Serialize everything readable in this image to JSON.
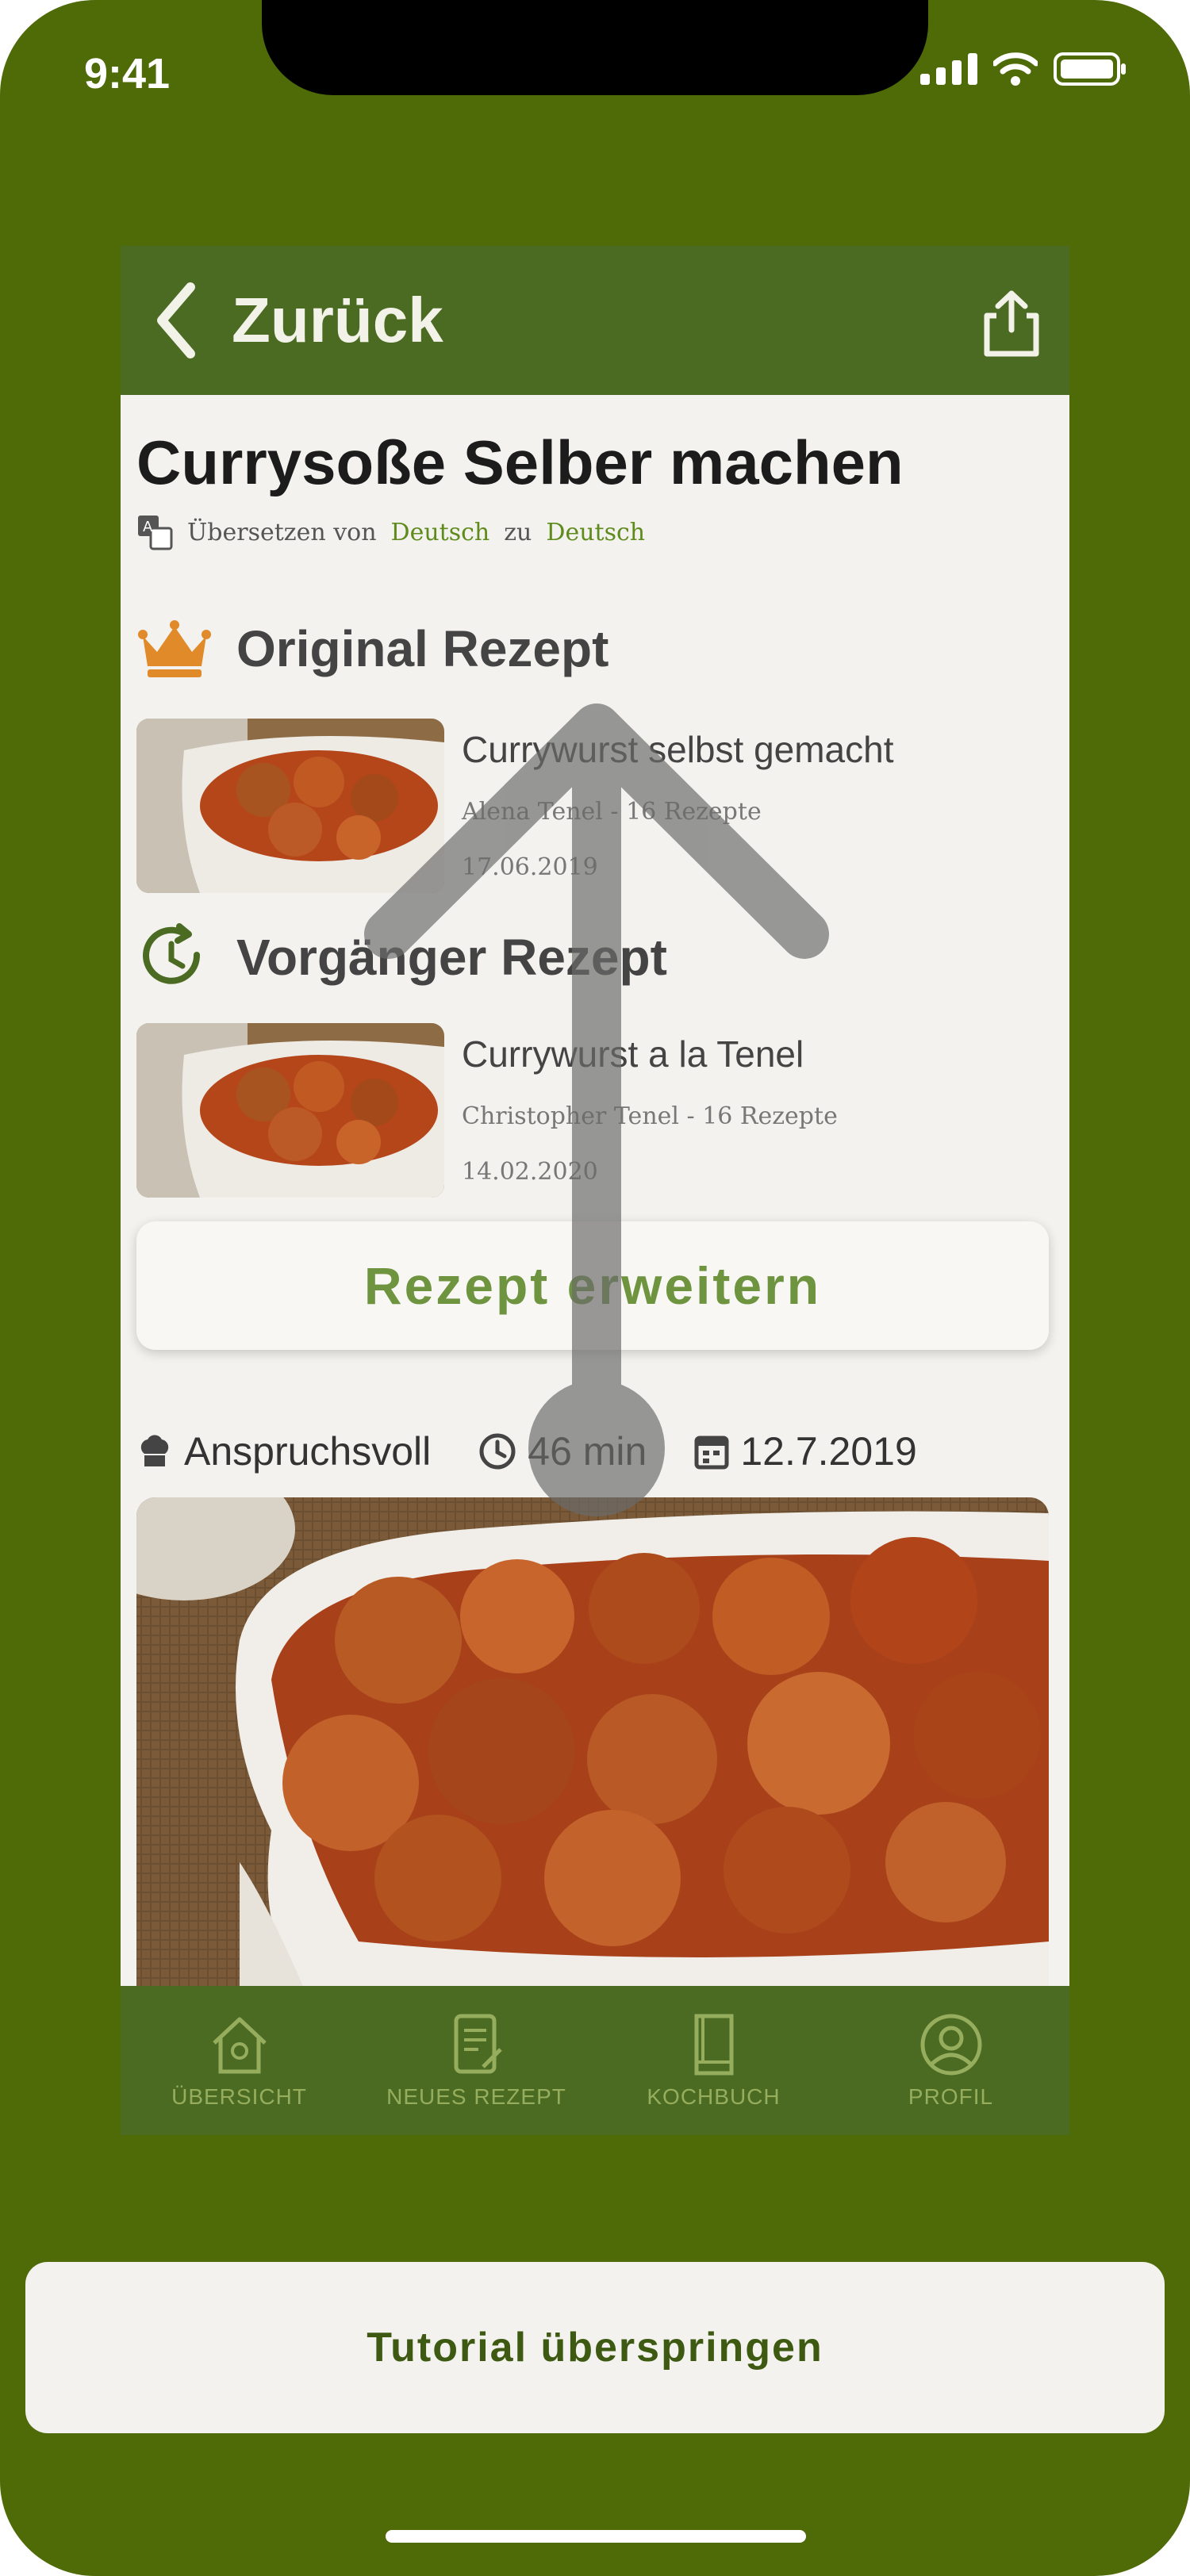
{
  "status_bar": {
    "time": "9:41"
  },
  "app_bar": {
    "back_label": "Zurück"
  },
  "recipe": {
    "title": "Currysoße Selber machen",
    "translation": {
      "prefix": "Übersetzen von",
      "from": "Deutsch",
      "connector": "zu",
      "to": "Deutsch"
    }
  },
  "original": {
    "heading": "Original Rezept",
    "title": "Currywurst selbst gemacht",
    "author_line": "Alena Tenel - 16 Rezepte",
    "date": "17.06.2019"
  },
  "predecessor": {
    "heading": "Vorgänger Rezept",
    "title": "Currywurst a la Tenel",
    "author_line": "Christopher Tenel - 16 Rezepte",
    "date": "14.02.2020"
  },
  "extend_button": "Rezept erweitern",
  "meta": {
    "difficulty": "Anspruchsvoll",
    "duration": "46 min",
    "date": "12.7.2019"
  },
  "tabs": [
    {
      "label": "ÜBERSICHT",
      "icon": "home-icon"
    },
    {
      "label": "NEUES REZEPT",
      "icon": "new-recipe-icon"
    },
    {
      "label": "KOCHBUCH",
      "icon": "cookbook-icon"
    },
    {
      "label": "PROFIL",
      "icon": "profile-icon"
    }
  ],
  "tutorial": {
    "skip_label": "Tutorial überspringen",
    "gesture": "swipe-up"
  },
  "colors": {
    "frame": "#4e6b08",
    "app_green": "#4b6b22",
    "accent_orange": "#e08a2a",
    "link_green": "#5f8a1c",
    "background": "#f3f2ee"
  }
}
